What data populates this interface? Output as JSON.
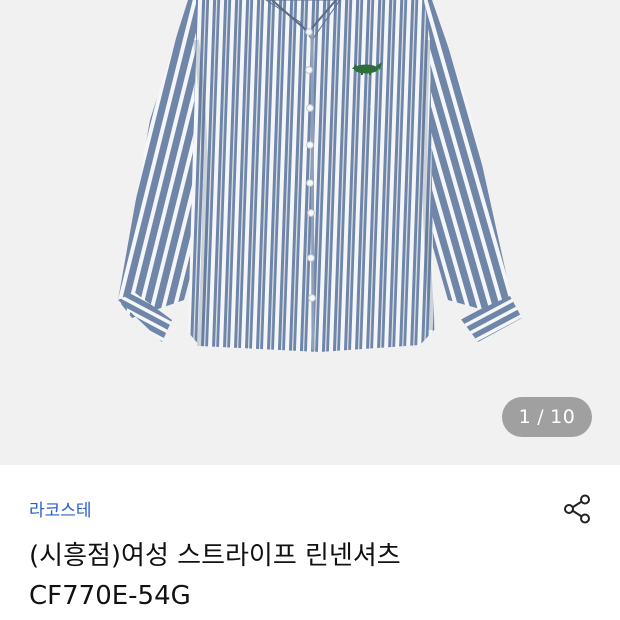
{
  "gallery": {
    "image_alt": "Blue and white striped linen shirt",
    "current": "1",
    "separator": "/",
    "total": "10"
  },
  "product": {
    "brand": "라코스테",
    "title_line1": "(시흥점)여성 스트라이프 린넨셔츠",
    "title_line2": "CF770E-54G"
  },
  "icons": {
    "share": "share-icon",
    "logo": "crocodile-logo-icon"
  },
  "colors": {
    "brand_link": "#2a5fc9",
    "stripe_blue": "#6f86a8",
    "stripe_white": "#f4f6f9"
  }
}
